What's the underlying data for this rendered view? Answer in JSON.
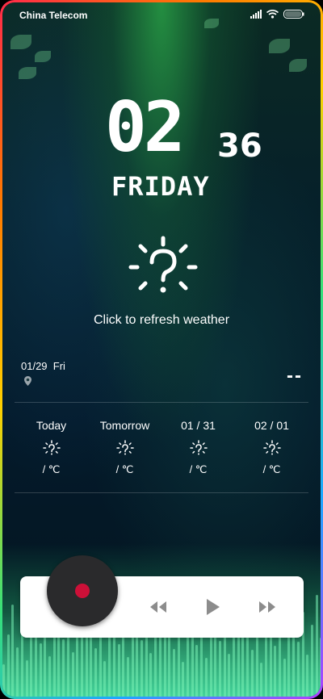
{
  "status_bar": {
    "carrier": "China Telecom"
  },
  "clock": {
    "hour": "02",
    "minute": "36",
    "day": "FRIDAY"
  },
  "weather": {
    "refresh_text": "Click to refresh weather",
    "date": "01/29",
    "weekday": "Fri",
    "temperature": "--",
    "icon": "sun-question-icon"
  },
  "forecast": [
    {
      "label": "Today",
      "temp": "/ ℃"
    },
    {
      "label": "Tomorrow",
      "temp": "/ ℃"
    },
    {
      "label": "01 / 31",
      "temp": "/ ℃"
    },
    {
      "label": "02 / 01",
      "temp": "/ ℃"
    }
  ],
  "music_player": {
    "accent_color": "#cc1038",
    "disc_color": "#2a2a2c"
  },
  "colors": {
    "text": "#ffffff",
    "bg_dark": "#041a2b",
    "grass": "#44d39a"
  }
}
